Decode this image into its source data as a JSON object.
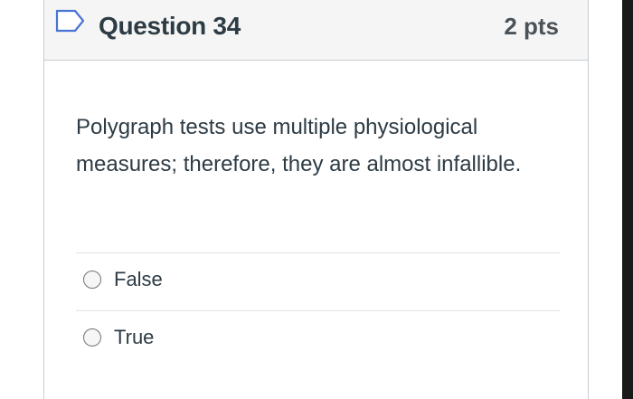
{
  "question": {
    "title": "Question 34",
    "points": "2 pts",
    "flag_icon": "flag-bookmark-icon",
    "text": "Polygraph tests use multiple physiological measures; therefore, they are almost infallible."
  },
  "answers": [
    {
      "label": "False",
      "selected": false
    },
    {
      "label": "True",
      "selected": false
    }
  ],
  "colors": {
    "flag_outline": "#4a73d6",
    "header_bg": "#f5f5f5",
    "text": "#2d3b45",
    "border": "#c7cdd1"
  }
}
